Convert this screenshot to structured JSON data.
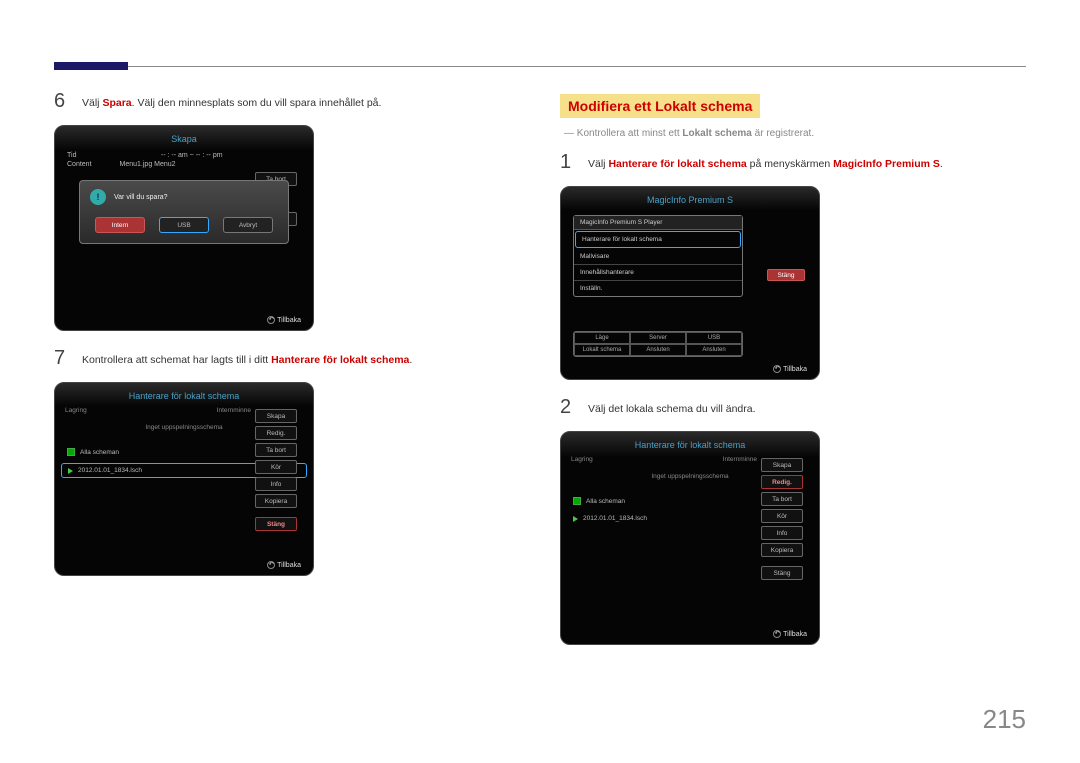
{
  "page": {
    "number": "215"
  },
  "left": {
    "step6": {
      "num": "6",
      "pre": "Välj ",
      "red": "Spara",
      "post": ". Välj den minnesplats som du vill spara innehållet på.",
      "panel": {
        "title": "Skapa",
        "tid_label": "Tid",
        "tid_meridian": "-- : -- am ~ -- : -- pm",
        "content_label": "Content",
        "content_value": "Menu1.jpg Menu2",
        "tabort_btn": "Ta bort",
        "avbryt_btn": "Avbryt",
        "modal_q": "Var vill du spara?",
        "btn_intern": "Intern",
        "btn_usb": "USB",
        "btn_avbryt": "Avbryt",
        "footer": "Tillbaka"
      }
    },
    "step7": {
      "num": "7",
      "pre": "Kontrollera att schemat har lagts till i ditt ",
      "red": "Hanterare för lokalt schema",
      "post": ".",
      "panel": {
        "title": "Hanterare för lokalt schema",
        "lagring": "Lagring",
        "storage": "Internminne",
        "empty_msg": "Inget uppspelningsschema",
        "all_label": "Alla scheman",
        "sched_name": "2012.01.01_1834.lsch",
        "btns": [
          "Skapa",
          "Redig.",
          "Ta bort",
          "Kör",
          "Info",
          "Kopiera",
          "Stäng"
        ],
        "footer": "Tillbaka"
      }
    }
  },
  "right": {
    "heading": "Modifiera ett Lokalt schema",
    "dashnote_pre": "― Kontrollera att minst ett ",
    "dashnote_bold": "Lokalt schema",
    "dashnote_post": " är registrerat.",
    "step1": {
      "num": "1",
      "pre": "Välj ",
      "red1": "Hanterare för lokalt schema",
      "mid": " på menyskärmen ",
      "red2": "MagicInfo Premium S",
      "post": ".",
      "panel": {
        "title": "MagicInfo Premium S",
        "list_header": "MagicInfo Premium S Player",
        "items": [
          "Hanterare för lokalt schema",
          "Mallvisare",
          "Innehållshanterare",
          "Inställn."
        ],
        "close": "Stäng",
        "table_r1": [
          "Läge",
          "Server",
          "USB"
        ],
        "table_r2": [
          "Lokalt schema",
          "Ansluten",
          "Ansluten"
        ],
        "footer": "Tillbaka"
      }
    },
    "step2": {
      "num": "2",
      "text": "Välj det lokala schema du vill ändra.",
      "panel": {
        "title": "Hanterare för lokalt schema",
        "lagring": "Lagring",
        "storage": "Internminne",
        "empty_msg": "Inget uppspelningsschema",
        "all_label": "Alla scheman",
        "sched_name": "2012.01.01_1834.lsch",
        "btns": [
          "Skapa",
          "Redig.",
          "Ta bort",
          "Kör",
          "Info",
          "Kopiera",
          "Stäng"
        ],
        "footer": "Tillbaka"
      }
    }
  }
}
